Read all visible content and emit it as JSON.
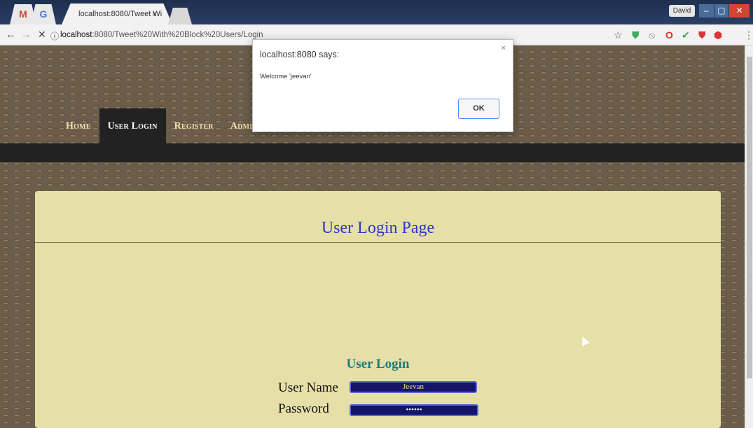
{
  "browser": {
    "gmail_tab": "M",
    "google_tab": "G",
    "active_tab_title": "localhost:8080/Tweet Wi",
    "tab_close": "×",
    "user_name": "David",
    "url_host": "localhost",
    "url_rest": ":8080/Tweet%20With%20Block%20Users/Login",
    "back": "←",
    "forward": "→",
    "stop": "✕",
    "info": "ⓘ",
    "star": "☆",
    "minimize": "–",
    "maximize": "▢",
    "close": "✕"
  },
  "nav": {
    "items": [
      "Home",
      "User Login",
      "Register",
      "Admin"
    ],
    "active_index": 1
  },
  "page": {
    "title": "User Login Page",
    "form_title": "User Login",
    "username_label": "User Name",
    "username_value": "Jeevan",
    "password_label": "Password",
    "password_value": "••••••"
  },
  "dialog": {
    "title": "localhost:8080 says:",
    "message": "Welcome 'jeevan'",
    "close": "×",
    "ok": "OK"
  },
  "colors": {
    "title_blue": "#2f36c9",
    "form_title_teal": "#1d7a7a",
    "panel": "#e6dfa8",
    "input_bg": "#141468"
  }
}
